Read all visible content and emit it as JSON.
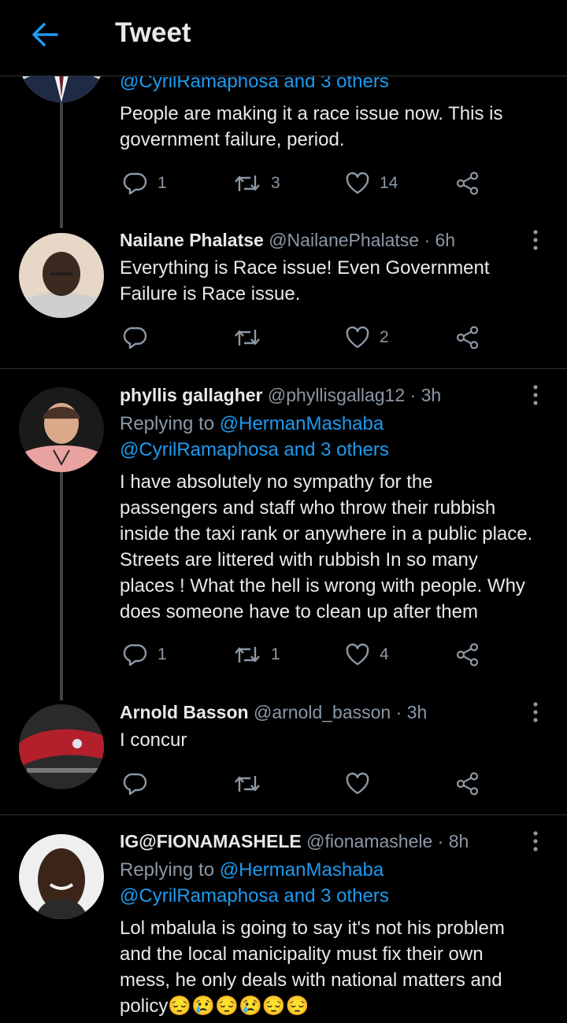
{
  "header": {
    "title": "Tweet"
  },
  "colors": {
    "background": "#000000",
    "link": "#1d9bf0",
    "muted": "#8b98a5",
    "text": "#e7e9ea"
  },
  "tweets": [
    {
      "replying_to_b": "@CyrilRamaphosa and 3 others",
      "text_lines": [
        "People are making it a race issue now. This is",
        "government failure, period."
      ],
      "replies": "1",
      "retweets": "3",
      "likes": "14"
    },
    {
      "name": "Nailane Phalatse",
      "handle": "@NailanePhalatse",
      "time": "· 6h",
      "text_lines": [
        "Everything is Race issue! Even Government",
        "Failure is Race issue."
      ],
      "replies": "",
      "retweets": "",
      "likes": "2"
    },
    {
      "name": "phyllis gallagher",
      "handle": "@phyllisgallag12",
      "time": "· 3h",
      "replying_label": "Replying to",
      "replying_to_a": "@HermanMashaba",
      "replying_to_b": "@CyrilRamaphosa and 3 others",
      "text_lines": [
        "I have absolutely no sympathy for the",
        "passengers and staff  who throw their rubbish",
        "inside the taxi rank or anywhere in a public place.",
        "Streets  are littered with rubbish In so many",
        "places ! What  the hell is wrong with people. Why",
        "does  someone have to clean up after them"
      ],
      "replies": "1",
      "retweets": "1",
      "likes": "4"
    },
    {
      "name": "Arnold Basson",
      "handle": "@arnold_basson",
      "time": "· 3h",
      "text_lines": [
        "I concur"
      ],
      "replies": "",
      "retweets": "",
      "likes": ""
    },
    {
      "name": "IG@FIONAMASHELE",
      "handle": "@fionamashele",
      "time": "· 8h",
      "replying_label": "Replying to",
      "replying_to_a": "@HermanMashaba",
      "replying_to_b": "@CyrilRamaphosa and 3 others",
      "text_lines": [
        "Lol mbalula is going to say it's not his problem",
        "and the local manicipality must fix their own",
        "mess, he only deals with national matters and",
        "policy😔😢😔😢😔😔"
      ]
    }
  ]
}
